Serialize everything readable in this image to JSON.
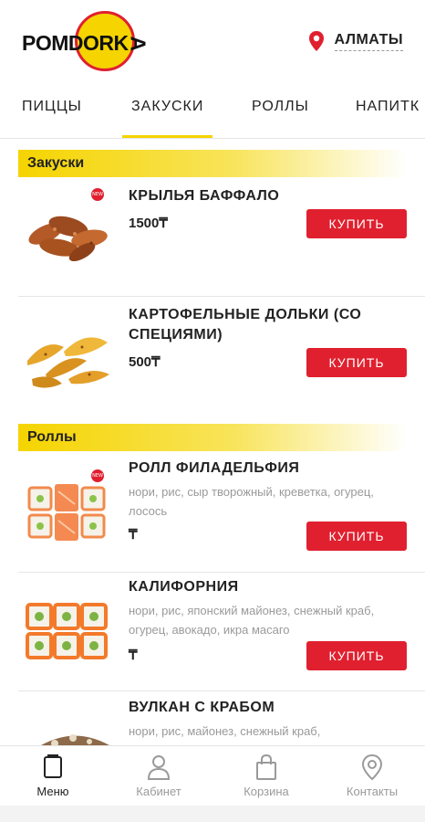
{
  "header": {
    "logo_text_left": "POM",
    "logo_text_mid": "DORK",
    "logo_text_end": "A",
    "city": "АЛМАТЫ"
  },
  "tabs": [
    {
      "label": "ПИЦЦЫ"
    },
    {
      "label": "ЗАКУСКИ"
    },
    {
      "label": "РОЛЛЫ"
    },
    {
      "label": "НАПИТК"
    }
  ],
  "sections": [
    {
      "title": "Закуски",
      "items": [
        {
          "name": "КРЫЛЬЯ БАФФАЛО",
          "price": "1500₸",
          "buy": "КУПИТЬ",
          "image": "chicken-wings-image",
          "badge": "new"
        },
        {
          "name": "КАРТОФЕЛЬНЫЕ ДОЛЬКИ (СО СПЕЦИЯМИ)",
          "price": "500₸",
          "buy": "КУПИТЬ",
          "image": "potato-wedges-image"
        }
      ]
    },
    {
      "title": "Роллы",
      "items": [
        {
          "name": "РОЛЛ ФИЛАДЕЛЬФИЯ",
          "desc": "нори, рис, сыр творожный, креветка, огурец, лосось",
          "price": "₸",
          "buy": "КУПИТЬ",
          "image": "philadelphia-roll-image",
          "badge": "new"
        },
        {
          "name": "КАЛИФОРНИЯ",
          "desc": "нори, рис, японский майонез, снежный краб, огурец, авокадо, икра масаго",
          "price": "₸",
          "buy": "КУПИТЬ",
          "image": "california-roll-image"
        },
        {
          "name": "ВУЛКАН С КРАБОМ",
          "desc": "нори, рис, майонез, снежный краб,",
          "image": "volcano-roll-image"
        }
      ]
    }
  ],
  "bottom_nav": [
    {
      "label": "Меню",
      "icon": "menu-icon",
      "active": true
    },
    {
      "label": "Кабинет",
      "icon": "user-icon"
    },
    {
      "label": "Корзина",
      "icon": "bag-icon"
    },
    {
      "label": "Контакты",
      "icon": "location-icon"
    }
  ],
  "colors": {
    "accent_red": "#e0202f",
    "accent_yellow": "#f5d400"
  }
}
